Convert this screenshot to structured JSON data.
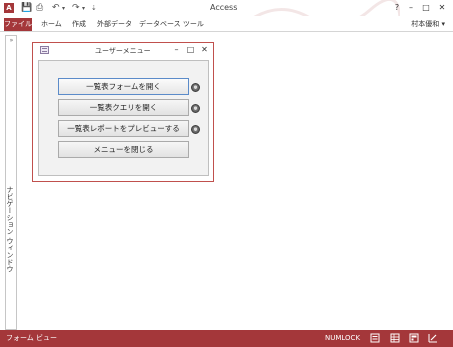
{
  "app": {
    "icon_letter": "A",
    "window_title": "Access",
    "help_glyph": "?",
    "minimize_glyph": "–",
    "restore_glyph": "□",
    "close_glyph": "✕"
  },
  "quick_access": {
    "save_glyph": "💾",
    "print_glyph": "⎙",
    "undo_glyph": "↶",
    "redo_glyph": "↷",
    "customize_glyph": "⇣"
  },
  "ribbon": {
    "tabs": [
      "ファイル",
      "ホーム",
      "作成",
      "外部データ",
      "データベース ツール"
    ],
    "user": "村本優和 ▾"
  },
  "nav_pane": {
    "collapse_glyph": "»",
    "label": "ナビゲーション ウィンドウ"
  },
  "form": {
    "title": "ユーザーメニュー",
    "minimize_glyph": "–",
    "restore_glyph": "□",
    "close_glyph": "✕",
    "buttons": [
      "一覧表フォームを開く",
      "一覧表クエリを開く",
      "一覧表レポートをプレビューする",
      "メニューを閉じる"
    ]
  },
  "status": {
    "view": "フォーム ビュー",
    "numlock": "NUMLOCK"
  },
  "colors": {
    "accent": "#a4373a",
    "form_border": "#c0504d"
  }
}
